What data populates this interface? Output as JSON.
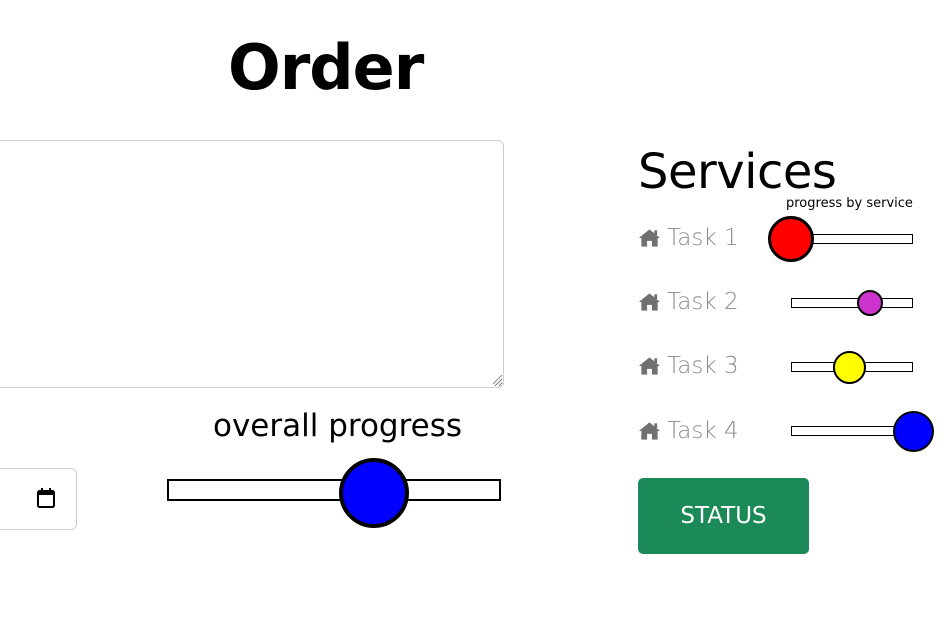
{
  "order": {
    "title": "Order",
    "textarea_value": "",
    "date_value": ""
  },
  "overall_progress": {
    "label": "overall progress",
    "value": 0.65,
    "thumb_color": "#0000ff"
  },
  "services": {
    "title": "Services",
    "caption": "progress by service",
    "tasks": [
      {
        "label": "Task 1",
        "icon": "home-icon",
        "value": 0.0,
        "thumb_color": "#ff0000"
      },
      {
        "label": "Task 2",
        "icon": "home-icon",
        "value": 0.65,
        "thumb_color": "#cc33cc"
      },
      {
        "label": "Task 3",
        "icon": "home-icon",
        "value": 0.48,
        "thumb_color": "#ffff00"
      },
      {
        "label": "Task 4",
        "icon": "home-icon",
        "value": 1.0,
        "thumb_color": "#0000ff"
      }
    ],
    "status_button_label": "STATUS",
    "status_button_color": "#1b8a58"
  }
}
